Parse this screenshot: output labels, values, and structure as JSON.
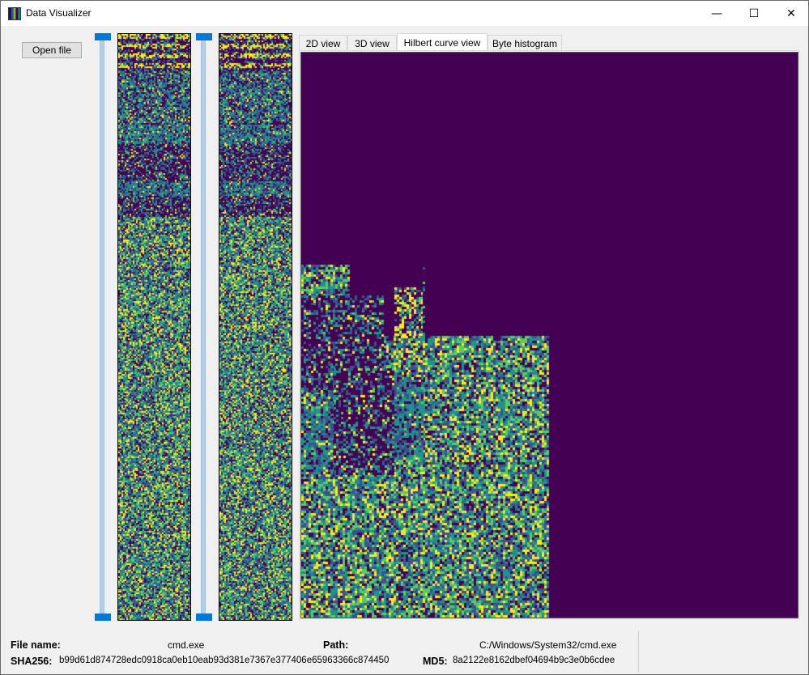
{
  "window": {
    "title": "Data Visualizer",
    "controls": {
      "minimize": "—",
      "maximize": "☐",
      "close": "✕"
    }
  },
  "toolbar": {
    "open_file_label": "Open file"
  },
  "sliders": [
    {
      "name": "overview-range-slider"
    },
    {
      "name": "detail-range-slider"
    }
  ],
  "tabs": [
    {
      "label": "2D view",
      "active": false
    },
    {
      "label": "3D view",
      "active": false
    },
    {
      "label": "Hilbert curve view",
      "active": true
    },
    {
      "label": "Byte histogram",
      "active": false
    }
  ],
  "file_info": {
    "file_name_label": "File name:",
    "file_name": "cmd.exe",
    "path_label": "Path:",
    "path": "C:/Windows/System32/cmd.exe",
    "sha256_label": "SHA256:",
    "sha256": "b99d61d874728edc0918ca0eb10eab93d381e7367e377406e65963366c874450",
    "md5_label": "MD5:",
    "md5": "8a2122e8162dbef04694b9c3e0b6cdee"
  },
  "colors": {
    "background": "#440154",
    "palette": [
      "#440154",
      "#3b528b",
      "#21918c",
      "#5ec962",
      "#fde725"
    ],
    "slider_handle": "#0078d7"
  }
}
